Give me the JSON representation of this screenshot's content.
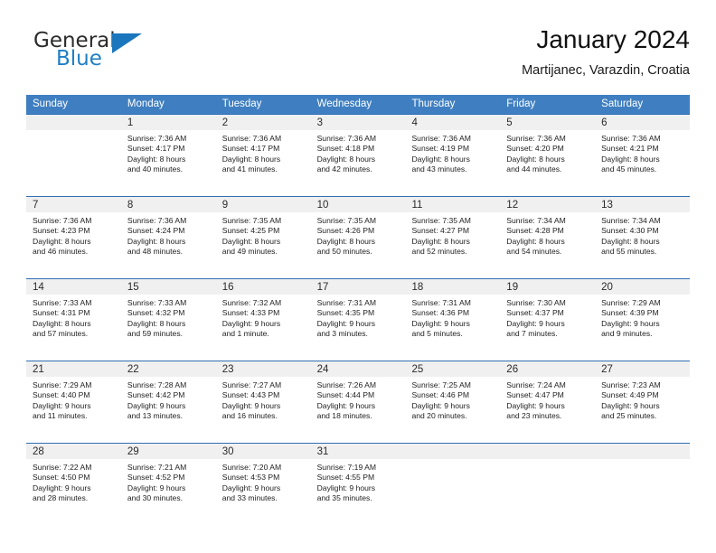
{
  "brand": {
    "name_part1": "General",
    "name_part2": "Blue",
    "triangle_color": "#1b76bd",
    "blue_color": "#1f7fc4"
  },
  "header": {
    "title": "January 2024",
    "subtitle": "Martijanec, Varazdin, Croatia"
  },
  "colors": {
    "header_band": "#3f7fc1",
    "week_separator": "#2f6fb3",
    "stripe": "#f0f0f0"
  },
  "weekdays": [
    "Sunday",
    "Monday",
    "Tuesday",
    "Wednesday",
    "Thursday",
    "Friday",
    "Saturday"
  ],
  "weeks": [
    {
      "days": [
        {
          "num": "",
          "sunrise": "",
          "sunset": "",
          "daylight1": "",
          "daylight2": ""
        },
        {
          "num": "1",
          "sunrise": "Sunrise: 7:36 AM",
          "sunset": "Sunset: 4:17 PM",
          "daylight1": "Daylight: 8 hours",
          "daylight2": "and 40 minutes."
        },
        {
          "num": "2",
          "sunrise": "Sunrise: 7:36 AM",
          "sunset": "Sunset: 4:17 PM",
          "daylight1": "Daylight: 8 hours",
          "daylight2": "and 41 minutes."
        },
        {
          "num": "3",
          "sunrise": "Sunrise: 7:36 AM",
          "sunset": "Sunset: 4:18 PM",
          "daylight1": "Daylight: 8 hours",
          "daylight2": "and 42 minutes."
        },
        {
          "num": "4",
          "sunrise": "Sunrise: 7:36 AM",
          "sunset": "Sunset: 4:19 PM",
          "daylight1": "Daylight: 8 hours",
          "daylight2": "and 43 minutes."
        },
        {
          "num": "5",
          "sunrise": "Sunrise: 7:36 AM",
          "sunset": "Sunset: 4:20 PM",
          "daylight1": "Daylight: 8 hours",
          "daylight2": "and 44 minutes."
        },
        {
          "num": "6",
          "sunrise": "Sunrise: 7:36 AM",
          "sunset": "Sunset: 4:21 PM",
          "daylight1": "Daylight: 8 hours",
          "daylight2": "and 45 minutes."
        }
      ]
    },
    {
      "days": [
        {
          "num": "7",
          "sunrise": "Sunrise: 7:36 AM",
          "sunset": "Sunset: 4:23 PM",
          "daylight1": "Daylight: 8 hours",
          "daylight2": "and 46 minutes."
        },
        {
          "num": "8",
          "sunrise": "Sunrise: 7:36 AM",
          "sunset": "Sunset: 4:24 PM",
          "daylight1": "Daylight: 8 hours",
          "daylight2": "and 48 minutes."
        },
        {
          "num": "9",
          "sunrise": "Sunrise: 7:35 AM",
          "sunset": "Sunset: 4:25 PM",
          "daylight1": "Daylight: 8 hours",
          "daylight2": "and 49 minutes."
        },
        {
          "num": "10",
          "sunrise": "Sunrise: 7:35 AM",
          "sunset": "Sunset: 4:26 PM",
          "daylight1": "Daylight: 8 hours",
          "daylight2": "and 50 minutes."
        },
        {
          "num": "11",
          "sunrise": "Sunrise: 7:35 AM",
          "sunset": "Sunset: 4:27 PM",
          "daylight1": "Daylight: 8 hours",
          "daylight2": "and 52 minutes."
        },
        {
          "num": "12",
          "sunrise": "Sunrise: 7:34 AM",
          "sunset": "Sunset: 4:28 PM",
          "daylight1": "Daylight: 8 hours",
          "daylight2": "and 54 minutes."
        },
        {
          "num": "13",
          "sunrise": "Sunrise: 7:34 AM",
          "sunset": "Sunset: 4:30 PM",
          "daylight1": "Daylight: 8 hours",
          "daylight2": "and 55 minutes."
        }
      ]
    },
    {
      "days": [
        {
          "num": "14",
          "sunrise": "Sunrise: 7:33 AM",
          "sunset": "Sunset: 4:31 PM",
          "daylight1": "Daylight: 8 hours",
          "daylight2": "and 57 minutes."
        },
        {
          "num": "15",
          "sunrise": "Sunrise: 7:33 AM",
          "sunset": "Sunset: 4:32 PM",
          "daylight1": "Daylight: 8 hours",
          "daylight2": "and 59 minutes."
        },
        {
          "num": "16",
          "sunrise": "Sunrise: 7:32 AM",
          "sunset": "Sunset: 4:33 PM",
          "daylight1": "Daylight: 9 hours",
          "daylight2": "and 1 minute."
        },
        {
          "num": "17",
          "sunrise": "Sunrise: 7:31 AM",
          "sunset": "Sunset: 4:35 PM",
          "daylight1": "Daylight: 9 hours",
          "daylight2": "and 3 minutes."
        },
        {
          "num": "18",
          "sunrise": "Sunrise: 7:31 AM",
          "sunset": "Sunset: 4:36 PM",
          "daylight1": "Daylight: 9 hours",
          "daylight2": "and 5 minutes."
        },
        {
          "num": "19",
          "sunrise": "Sunrise: 7:30 AM",
          "sunset": "Sunset: 4:37 PM",
          "daylight1": "Daylight: 9 hours",
          "daylight2": "and 7 minutes."
        },
        {
          "num": "20",
          "sunrise": "Sunrise: 7:29 AM",
          "sunset": "Sunset: 4:39 PM",
          "daylight1": "Daylight: 9 hours",
          "daylight2": "and 9 minutes."
        }
      ]
    },
    {
      "days": [
        {
          "num": "21",
          "sunrise": "Sunrise: 7:29 AM",
          "sunset": "Sunset: 4:40 PM",
          "daylight1": "Daylight: 9 hours",
          "daylight2": "and 11 minutes."
        },
        {
          "num": "22",
          "sunrise": "Sunrise: 7:28 AM",
          "sunset": "Sunset: 4:42 PM",
          "daylight1": "Daylight: 9 hours",
          "daylight2": "and 13 minutes."
        },
        {
          "num": "23",
          "sunrise": "Sunrise: 7:27 AM",
          "sunset": "Sunset: 4:43 PM",
          "daylight1": "Daylight: 9 hours",
          "daylight2": "and 16 minutes."
        },
        {
          "num": "24",
          "sunrise": "Sunrise: 7:26 AM",
          "sunset": "Sunset: 4:44 PM",
          "daylight1": "Daylight: 9 hours",
          "daylight2": "and 18 minutes."
        },
        {
          "num": "25",
          "sunrise": "Sunrise: 7:25 AM",
          "sunset": "Sunset: 4:46 PM",
          "daylight1": "Daylight: 9 hours",
          "daylight2": "and 20 minutes."
        },
        {
          "num": "26",
          "sunrise": "Sunrise: 7:24 AM",
          "sunset": "Sunset: 4:47 PM",
          "daylight1": "Daylight: 9 hours",
          "daylight2": "and 23 minutes."
        },
        {
          "num": "27",
          "sunrise": "Sunrise: 7:23 AM",
          "sunset": "Sunset: 4:49 PM",
          "daylight1": "Daylight: 9 hours",
          "daylight2": "and 25 minutes."
        }
      ]
    },
    {
      "days": [
        {
          "num": "28",
          "sunrise": "Sunrise: 7:22 AM",
          "sunset": "Sunset: 4:50 PM",
          "daylight1": "Daylight: 9 hours",
          "daylight2": "and 28 minutes."
        },
        {
          "num": "29",
          "sunrise": "Sunrise: 7:21 AM",
          "sunset": "Sunset: 4:52 PM",
          "daylight1": "Daylight: 9 hours",
          "daylight2": "and 30 minutes."
        },
        {
          "num": "30",
          "sunrise": "Sunrise: 7:20 AM",
          "sunset": "Sunset: 4:53 PM",
          "daylight1": "Daylight: 9 hours",
          "daylight2": "and 33 minutes."
        },
        {
          "num": "31",
          "sunrise": "Sunrise: 7:19 AM",
          "sunset": "Sunset: 4:55 PM",
          "daylight1": "Daylight: 9 hours",
          "daylight2": "and 35 minutes."
        },
        {
          "num": "",
          "sunrise": "",
          "sunset": "",
          "daylight1": "",
          "daylight2": ""
        },
        {
          "num": "",
          "sunrise": "",
          "sunset": "",
          "daylight1": "",
          "daylight2": ""
        },
        {
          "num": "",
          "sunrise": "",
          "sunset": "",
          "daylight1": "",
          "daylight2": ""
        }
      ]
    }
  ]
}
